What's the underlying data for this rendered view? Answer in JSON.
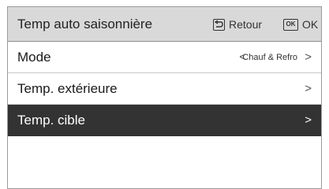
{
  "header": {
    "title": "Temp auto saisonnière",
    "back_label": "Retour",
    "ok_icon_text": "OK",
    "ok_label": "OK"
  },
  "menu": {
    "items": [
      {
        "label": "Mode",
        "value": "Chauf & Refro",
        "chevron_left": "<",
        "chevron_right": ">"
      },
      {
        "label": "Temp. extérieure",
        "chevron_right": ">"
      },
      {
        "label": "Temp. cible",
        "chevron_right": ">",
        "selected": true
      }
    ]
  },
  "colors": {
    "header_bg": "#d9d9d9",
    "selected_bg": "#333333",
    "text": "#1a1a1a"
  },
  "icons": {
    "back": "back-arrow-icon",
    "ok": "ok-icon",
    "chevron": "chevron-right-icon"
  }
}
